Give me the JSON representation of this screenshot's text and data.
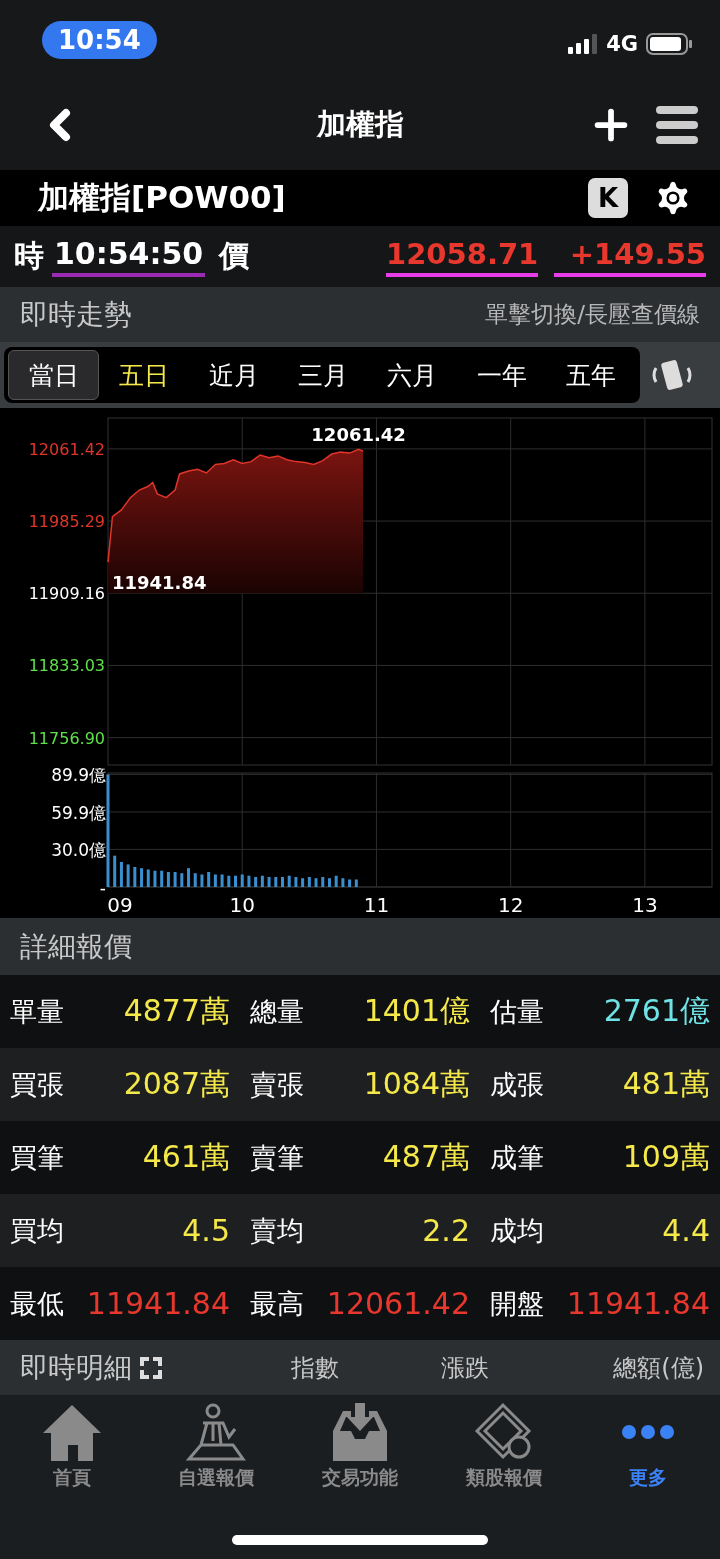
{
  "status_bar": {
    "time": "10:54",
    "network": "4G"
  },
  "nav": {
    "title": "加權指"
  },
  "stock": {
    "name": "加權指[POW00]",
    "k_button": "K"
  },
  "quote": {
    "time_label": "時",
    "time": "10:54:50",
    "price_label": "價",
    "price": "12058.71",
    "change": "+149.55"
  },
  "trend_header": {
    "title": "即時走勢",
    "hint": "單擊切換/長壓查價線"
  },
  "periods": [
    {
      "label": "當日",
      "selected": true,
      "accent": false
    },
    {
      "label": "五日",
      "selected": false,
      "accent": true
    },
    {
      "label": "近月",
      "selected": false,
      "accent": false
    },
    {
      "label": "三月",
      "selected": false,
      "accent": false
    },
    {
      "label": "六月",
      "selected": false,
      "accent": false
    },
    {
      "label": "一年",
      "selected": false,
      "accent": false
    },
    {
      "label": "五年",
      "selected": false,
      "accent": false
    }
  ],
  "price_chart": {
    "chart_data": {
      "type": "area",
      "x": [
        9,
        9.033,
        9.1,
        9.167,
        9.233,
        9.3,
        9.333,
        9.367,
        9.433,
        9.5,
        9.533,
        9.6,
        9.667,
        9.733,
        9.8,
        9.867,
        9.933,
        10,
        10.067,
        10.133,
        10.2,
        10.267,
        10.333,
        10.4,
        10.467,
        10.533,
        10.6,
        10.667,
        10.733,
        10.8,
        10.867,
        10.9
      ],
      "series": [
        {
          "color": "#e0342a",
          "values": [
            11942,
            11990,
            11997,
            12010,
            12018,
            12022,
            12026,
            12014,
            12010,
            12018,
            12035,
            12038,
            12040,
            12036,
            12045,
            12046,
            12050,
            12046,
            12048,
            12055,
            12052,
            12054,
            12050,
            12048,
            12047,
            12045,
            12049,
            12056,
            12058,
            12057,
            12061,
            12059
          ]
        }
      ],
      "xlim": [
        9,
        13.5
      ],
      "ylim": [
        11728,
        12094
      ],
      "grid": true,
      "yticks": [
        {
          "value": 12061.42,
          "label": "12061.42"
        },
        {
          "value": 11985.29,
          "label": "11985.29"
        },
        {
          "value": 11909.16,
          "label": "11909.16"
        },
        {
          "value": 11833.03,
          "label": "11833.03"
        },
        {
          "value": 11756.9,
          "label": "11756.90"
        }
      ],
      "annotations": [
        {
          "x": 10.867,
          "y": 12061.42,
          "text": "12061.42"
        },
        {
          "x": 9,
          "y": 11941.84,
          "text": "11941.84"
        }
      ]
    }
  },
  "volume_chart": {
    "chart_data": {
      "type": "bar",
      "x": [
        9,
        9.05,
        9.1,
        9.15,
        9.2,
        9.25,
        9.3,
        9.35,
        9.4,
        9.45,
        9.5,
        9.55,
        9.6,
        9.65,
        9.7,
        9.75,
        9.8,
        9.85,
        9.9,
        9.95,
        10,
        10.05,
        10.1,
        10.15,
        10.2,
        10.25,
        10.3,
        10.35,
        10.4,
        10.45,
        10.5,
        10.55,
        10.6,
        10.65,
        10.7,
        10.75,
        10.8,
        10.85
      ],
      "series": [
        {
          "color": "#3a8fd0",
          "values": [
            89.9,
            25,
            20,
            18,
            16,
            15,
            14,
            13,
            13,
            12,
            12,
            11,
            15,
            11,
            10,
            12,
            10,
            10,
            9,
            9,
            10,
            9,
            8,
            9,
            8,
            8,
            8,
            9,
            8,
            7,
            8,
            7,
            8,
            7,
            9,
            7,
            6,
            6
          ]
        }
      ],
      "xlim": [
        9,
        13.5
      ],
      "ylim": [
        0,
        91
      ],
      "grid": true,
      "yticks": [
        {
          "value": 89.9,
          "label": "89.9億"
        },
        {
          "value": 59.9,
          "label": "59.9億"
        },
        {
          "value": 30,
          "label": "30.0億"
        },
        {
          "value": 0,
          "label": "-"
        }
      ],
      "xticks": [
        {
          "value": 9,
          "label": "09"
        },
        {
          "value": 10,
          "label": "10"
        },
        {
          "value": 11,
          "label": "11"
        },
        {
          "value": 12,
          "label": "12"
        },
        {
          "value": 13,
          "label": "13"
        }
      ]
    }
  },
  "detail": {
    "title": "詳細報價",
    "rows": [
      [
        {
          "label": "單量",
          "value": "4877萬",
          "color": "#f4e84a"
        },
        {
          "label": "總量",
          "value": "1401億",
          "color": "#f4e84a"
        },
        {
          "label": "估量",
          "value": "2761億",
          "color": "#6fe3e6"
        }
      ],
      [
        {
          "label": "買張",
          "value": "2087萬",
          "color": "#f4e84a"
        },
        {
          "label": "賣張",
          "value": "1084萬",
          "color": "#f4e84a"
        },
        {
          "label": "成張",
          "value": "481萬",
          "color": "#f4e84a"
        }
      ],
      [
        {
          "label": "買筆",
          "value": "461萬",
          "color": "#f4e84a"
        },
        {
          "label": "賣筆",
          "value": "487萬",
          "color": "#f4e84a"
        },
        {
          "label": "成筆",
          "value": "109萬",
          "color": "#f4e84a"
        }
      ],
      [
        {
          "label": "買均",
          "value": "4.5",
          "color": "#f4e84a"
        },
        {
          "label": "賣均",
          "value": "2.2",
          "color": "#f4e84a"
        },
        {
          "label": "成均",
          "value": "4.4",
          "color": "#f4e84a"
        }
      ],
      [
        {
          "label": "最低",
          "value": "11941.84",
          "color": "#e8372d"
        },
        {
          "label": "最高",
          "value": "12061.42",
          "color": "#e8372d"
        },
        {
          "label": "開盤",
          "value": "11941.84",
          "color": "#e8372d"
        }
      ]
    ]
  },
  "ticks_header": {
    "title": "即時明細",
    "columns": [
      "指數",
      "漲跌",
      "總額(億)"
    ]
  },
  "tab_bar": [
    {
      "kind": "home",
      "label": "首頁",
      "selected": false
    },
    {
      "kind": "watchlist",
      "label": "自選報價",
      "selected": false
    },
    {
      "kind": "trade",
      "label": "交易功能",
      "selected": false
    },
    {
      "kind": "sector",
      "label": "類股報價",
      "selected": false
    },
    {
      "kind": "more",
      "label": "更多",
      "selected": true
    }
  ]
}
